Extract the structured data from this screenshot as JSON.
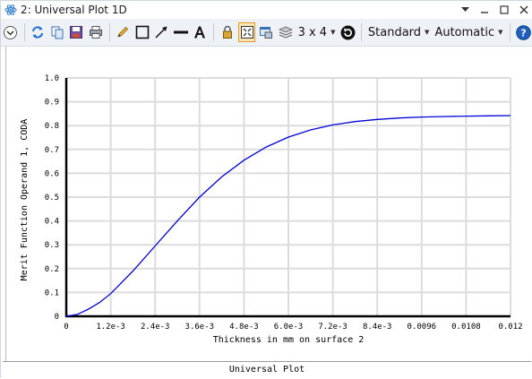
{
  "window": {
    "title": "2: Universal Plot 1D"
  },
  "toolbar": {
    "icons": [
      "expand-icon",
      "refresh-icon",
      "copy-icon",
      "save-icon",
      "print-icon",
      "pencil-icon",
      "rectangle-icon",
      "arrow-icon",
      "line-icon",
      "text-icon",
      "lock-icon",
      "fit-icon",
      "window-icon",
      "layers-icon",
      "reset-icon",
      "help-icon"
    ],
    "layout_label": "3 x 4",
    "standard_label": "Standard",
    "automatic_label": "Automatic"
  },
  "footer": {
    "title": "Universal Plot"
  },
  "colors": {
    "series": "#0000dd",
    "grid": "#dcdcdc",
    "selected_border": "#e39a1b",
    "selected_fill": "#fde7b8"
  },
  "chart_data": {
    "type": "line",
    "title": "",
    "xlabel": "Thickness in mm on surface 2",
    "ylabel": "Merit Function Operand 1, CODA",
    "xlim": [
      0,
      0.012
    ],
    "ylim": [
      0,
      1.0
    ],
    "x_ticks": [
      "0",
      "1.2e-3",
      "2.4e-3",
      "3.6e-3",
      "4.8e-3",
      "6.0e-3",
      "7.2e-3",
      "8.4e-3",
      "0.0096",
      "0.0108",
      "0.012"
    ],
    "y_ticks": [
      "0",
      "0.1",
      "0.2",
      "0.3",
      "0.4",
      "0.5",
      "0.6",
      "0.7",
      "0.8",
      "0.9",
      "1.0"
    ],
    "grid": true,
    "series": [
      {
        "x": [
          0,
          0.0003,
          0.0006,
          0.0009,
          0.0012,
          0.0018,
          0.0024,
          0.003,
          0.0036,
          0.0042,
          0.0048,
          0.0054,
          0.006,
          0.0066,
          0.0072,
          0.0078,
          0.0084,
          0.009,
          0.0096,
          0.0102,
          0.0108,
          0.0114,
          0.012
        ],
        "values": [
          0.0,
          0.008,
          0.03,
          0.058,
          0.095,
          0.19,
          0.295,
          0.4,
          0.5,
          0.585,
          0.655,
          0.71,
          0.752,
          0.782,
          0.803,
          0.817,
          0.826,
          0.832,
          0.836,
          0.838,
          0.84,
          0.841,
          0.842
        ]
      }
    ]
  }
}
